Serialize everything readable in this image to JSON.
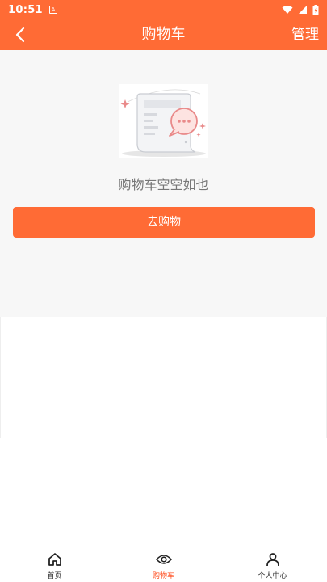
{
  "status_bar": {
    "time": "10:51",
    "app_icon_letter": "A"
  },
  "nav": {
    "title": "购物车",
    "manage_label": "管理"
  },
  "empty_state": {
    "message": "购物车空空如也",
    "button_label": "去购物"
  },
  "tabs": [
    {
      "label": "首页",
      "icon": "home-icon",
      "active": false
    },
    {
      "label": "购物车",
      "icon": "eye-icon",
      "active": true
    },
    {
      "label": "个人中心",
      "icon": "person-icon",
      "active": false
    }
  ],
  "colors": {
    "brand": "#ff6b35",
    "active_tab": "#ff4a1a",
    "panel_bg": "#f7f7f7"
  }
}
